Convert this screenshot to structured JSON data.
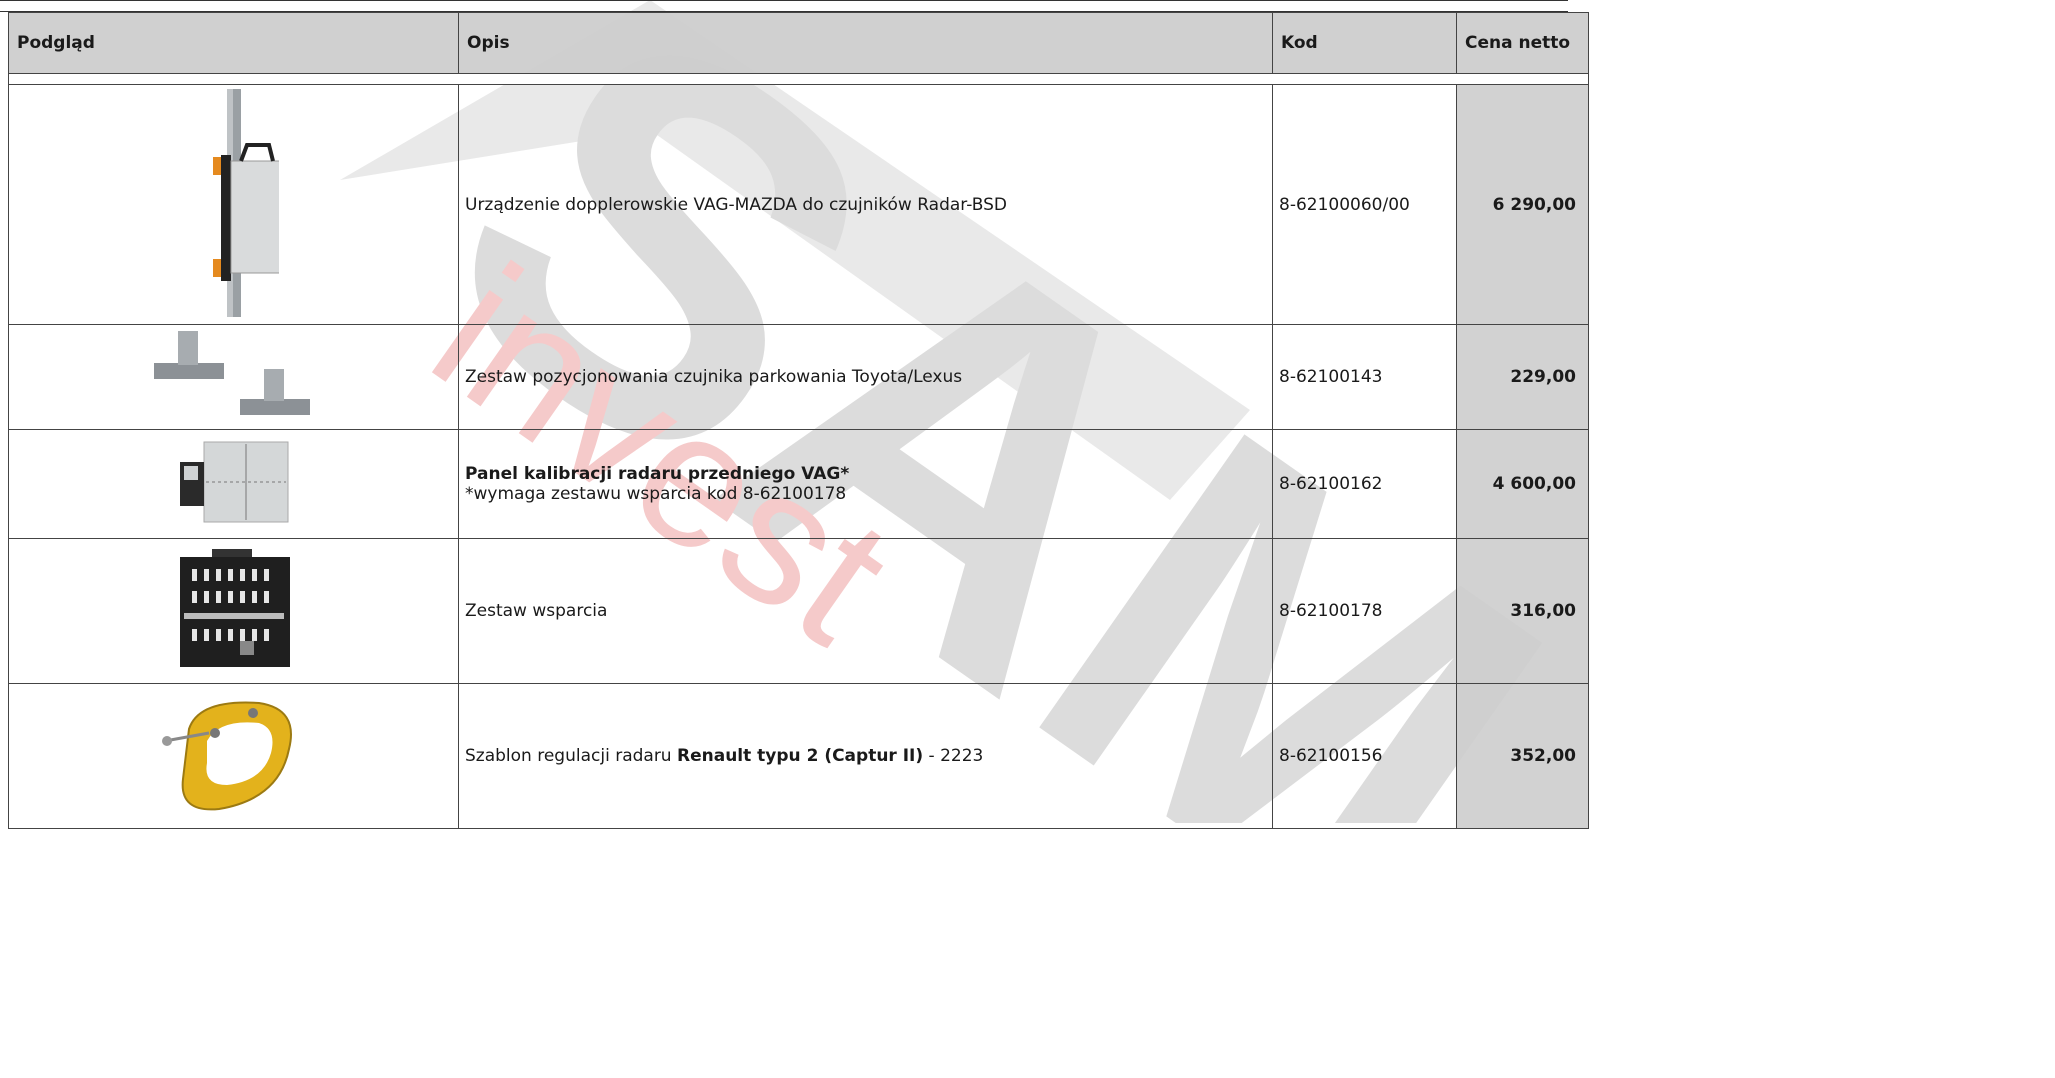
{
  "watermark": {
    "brand": "SAM",
    "tagline": "invest"
  },
  "table": {
    "headers": {
      "preview": "Podgląd",
      "description": "Opis",
      "code": "Kod",
      "price": "Cena netto"
    },
    "rows": [
      {
        "image": "doppler-radar-device-icon",
        "description": "Urządzenie dopplerowskie VAG-MAZDA do czujników Radar-BSD",
        "code": "8-62100060/00",
        "price": "6 290,00"
      },
      {
        "image": "parking-sensor-positioning-kit-icon",
        "description": "Zestaw pozycjonowania czujnika parkowania Toyota/Lexus",
        "code": "8-62100143",
        "price": "229,00"
      },
      {
        "image": "radar-calibration-panel-icon",
        "description_bold": "Panel kalibracji radaru przedniego VAG*",
        "description": "*wymaga zestawu wsparcia kod 8-62100178",
        "code": "8-62100162",
        "price": "4 600,00"
      },
      {
        "image": "support-kit-plate-icon",
        "description": "Zestaw wsparcia",
        "code": "8-62100178",
        "price": "316,00"
      },
      {
        "image": "radar-adjustment-template-icon",
        "description_prefix": "Szablon regulacji radaru ",
        "description_bold": "Renault typu 2 (Captur II)",
        "description_suffix": " - 2223",
        "code": "8-62100156",
        "price": "352,00"
      }
    ]
  }
}
